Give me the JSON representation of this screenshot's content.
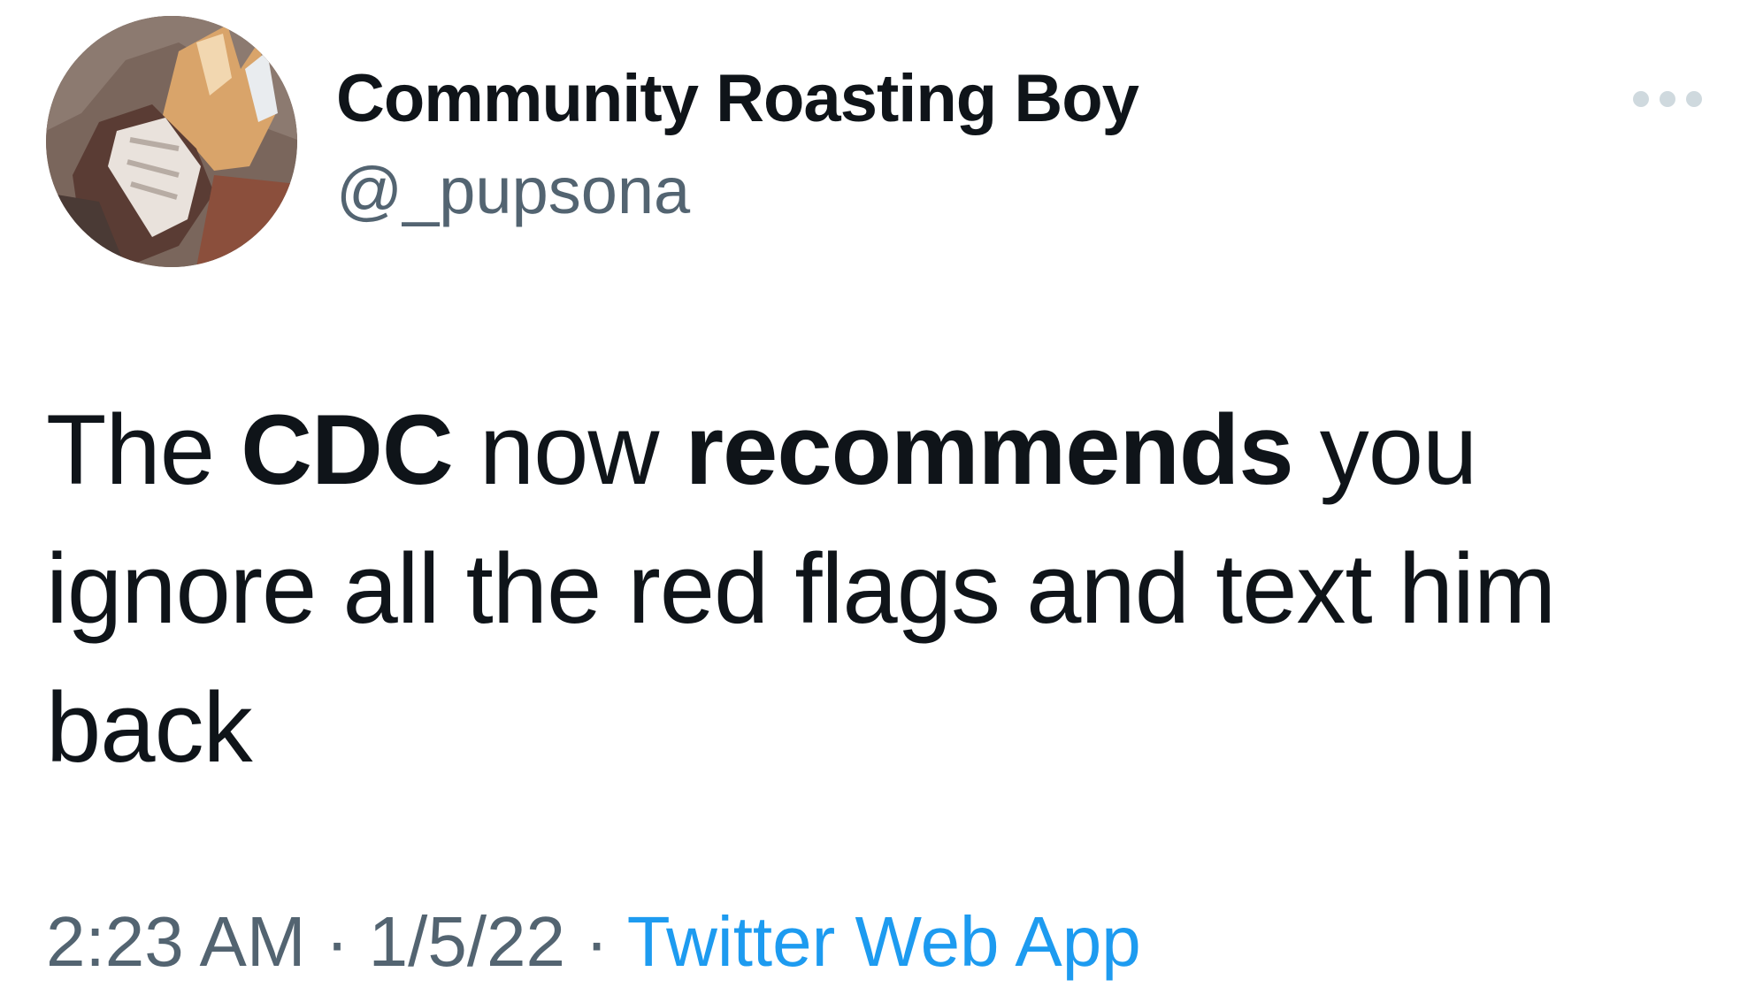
{
  "author": {
    "display_name": "Community Roasting Boy",
    "handle": "@_pupsona",
    "avatar_description": "furry-character-avatar"
  },
  "menu": {
    "icon": "more-horizontal-icon"
  },
  "tweet": {
    "text_parts": [
      "The ",
      "CDC",
      " now ",
      "recommends",
      " you ignore all the red flags and text him back"
    ]
  },
  "meta": {
    "time": "2:23 AM",
    "separator": " · ",
    "date": "1/5/22",
    "source": "Twitter Web App"
  },
  "colors": {
    "text_primary": "#0f1419",
    "text_secondary": "#536471",
    "link": "#1d9bf0",
    "icon_light": "#cfd9de"
  }
}
